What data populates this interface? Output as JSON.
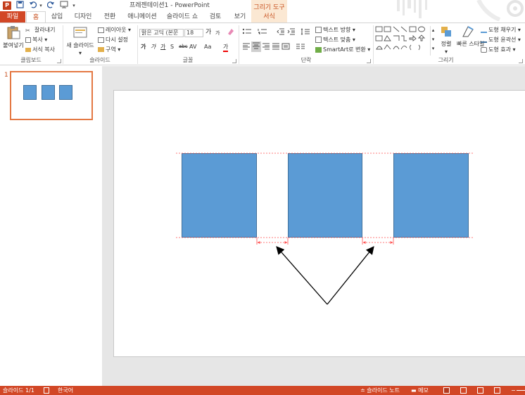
{
  "window": {
    "app_icon": "P",
    "title": "프레젠테이션1 - PowerPoint",
    "context_group": "그리기 도구"
  },
  "quick_access": {
    "save_icon": "save-icon",
    "undo_icon": "undo-icon",
    "redo_icon": "redo-icon",
    "start_icon": "start-from-beginning-icon",
    "customize": "▾"
  },
  "tabs": [
    {
      "label": "파일"
    },
    {
      "label": "홈"
    },
    {
      "label": "삽입"
    },
    {
      "label": "디자인"
    },
    {
      "label": "전환"
    },
    {
      "label": "애니메이션"
    },
    {
      "label": "슬라이드 쇼"
    },
    {
      "label": "검토"
    },
    {
      "label": "보기"
    },
    {
      "label": "서식"
    }
  ],
  "ribbon": {
    "clipboard": {
      "label": "클립보드",
      "paste": "붙여넣기",
      "cut": "잘라내기",
      "copy": "복사",
      "format_painter": "서식 복사"
    },
    "slides": {
      "label": "슬라이드",
      "new_slide": "새 슬라이드",
      "layout": "레이아웃",
      "reset": "다시 설정",
      "section": "구역"
    },
    "font": {
      "label": "글꼴",
      "font_name": "맑은 고딕 (본문",
      "font_size": "18",
      "grow": "가",
      "shrink": "가",
      "bold": "가",
      "italic": "가",
      "underline": "가",
      "shadow": "S",
      "strike": "abc",
      "spacing": "AV",
      "case": "Aa",
      "color": "가"
    },
    "paragraph": {
      "label": "단락",
      "text_direction": "텍스트 방향",
      "align_text": "텍스트 맞춤",
      "smartart": "SmartArt로 변환"
    },
    "drawing": {
      "label": "그리기",
      "arrange": "정렬",
      "quick_styles": "빠른 스타일",
      "shape_fill": "도형 채우기",
      "shape_outline": "도형 윤곽선",
      "shape_effects": "도형 효과"
    }
  },
  "thumbnails": {
    "slide_number": "1"
  },
  "statusbar": {
    "slide_info": "슬라이드 1/1",
    "language": "한국어",
    "notes": "슬라이드 노트",
    "comments": "메모",
    "zoom_minus": "−"
  },
  "colors": {
    "accent": "#d24726",
    "shape_fill": "#5b9bd5",
    "shape_border": "#41719c",
    "guide": "#ff5050"
  }
}
